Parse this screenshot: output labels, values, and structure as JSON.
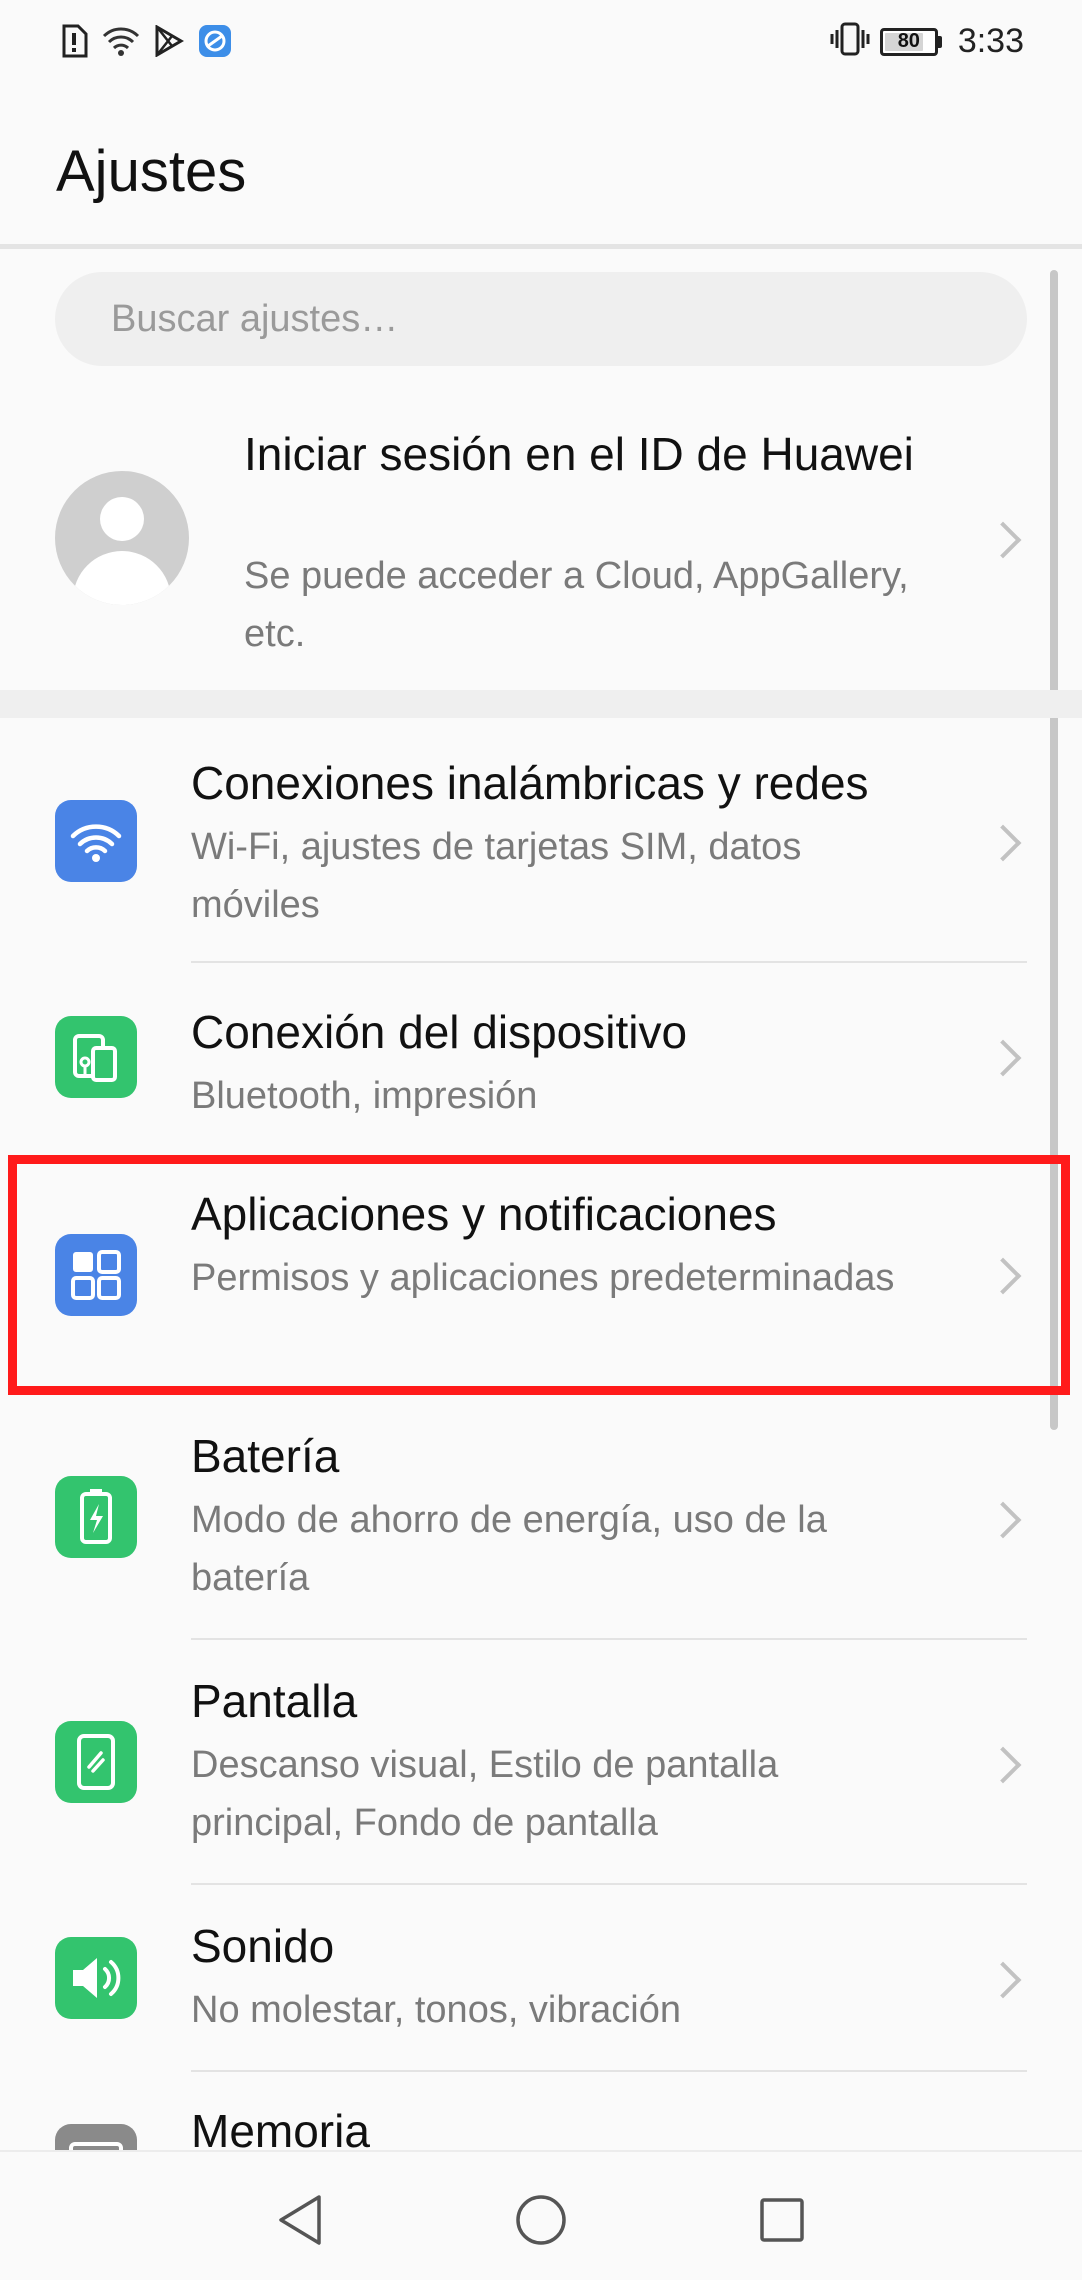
{
  "status_bar": {
    "time": "3:33",
    "battery_level": "80",
    "battery_fraction": 0.8,
    "left_icons": [
      "alert-icon",
      "wifi-icon",
      "play-store-icon",
      "app-icon"
    ],
    "right_icons": [
      "vibrate-icon",
      "battery-icon"
    ]
  },
  "header": {
    "title": "Ajustes"
  },
  "search": {
    "placeholder": "Buscar ajustes…"
  },
  "account": {
    "title": "Iniciar sesión en el ID de Huawei",
    "subtitle": "Se puede acceder a Cloud, AppGallery, etc."
  },
  "settings": {
    "items": [
      {
        "title": "Conexiones inalámbricas y redes",
        "subtitle": "Wi-Fi, ajustes de tarjetas SIM, datos móviles",
        "icon": "wifi-icon",
        "color": "#4a84e6"
      },
      {
        "title": "Conexión del dispositivo",
        "subtitle": "Bluetooth, impresión",
        "icon": "device-connection-icon",
        "color": "#33c46e"
      },
      {
        "title": "Aplicaciones y notificaciones",
        "subtitle": "Permisos y aplicaciones predeterminadas",
        "icon": "apps-grid-icon",
        "color": "#4a84e6"
      },
      {
        "title": "Batería",
        "subtitle": "Modo de ahorro de energía, uso de la batería",
        "icon": "battery-icon",
        "color": "#33c46e"
      },
      {
        "title": "Pantalla",
        "subtitle": "Descanso visual, Estilo de pantalla principal, Fondo de pantalla",
        "icon": "display-icon",
        "color": "#33c46e"
      },
      {
        "title": "Sonido",
        "subtitle": "No molestar, tonos, vibración",
        "icon": "speaker-icon",
        "color": "#33c46e"
      },
      {
        "title": "Memoria",
        "subtitle": "",
        "icon": "storage-icon",
        "color": "#8a8a8a"
      }
    ]
  },
  "highlight": {
    "color": "#ff1a1a",
    "target": "Aplicaciones y notificaciones"
  },
  "navigation": {
    "buttons": [
      "back-icon",
      "home-icon",
      "recents-icon"
    ]
  }
}
